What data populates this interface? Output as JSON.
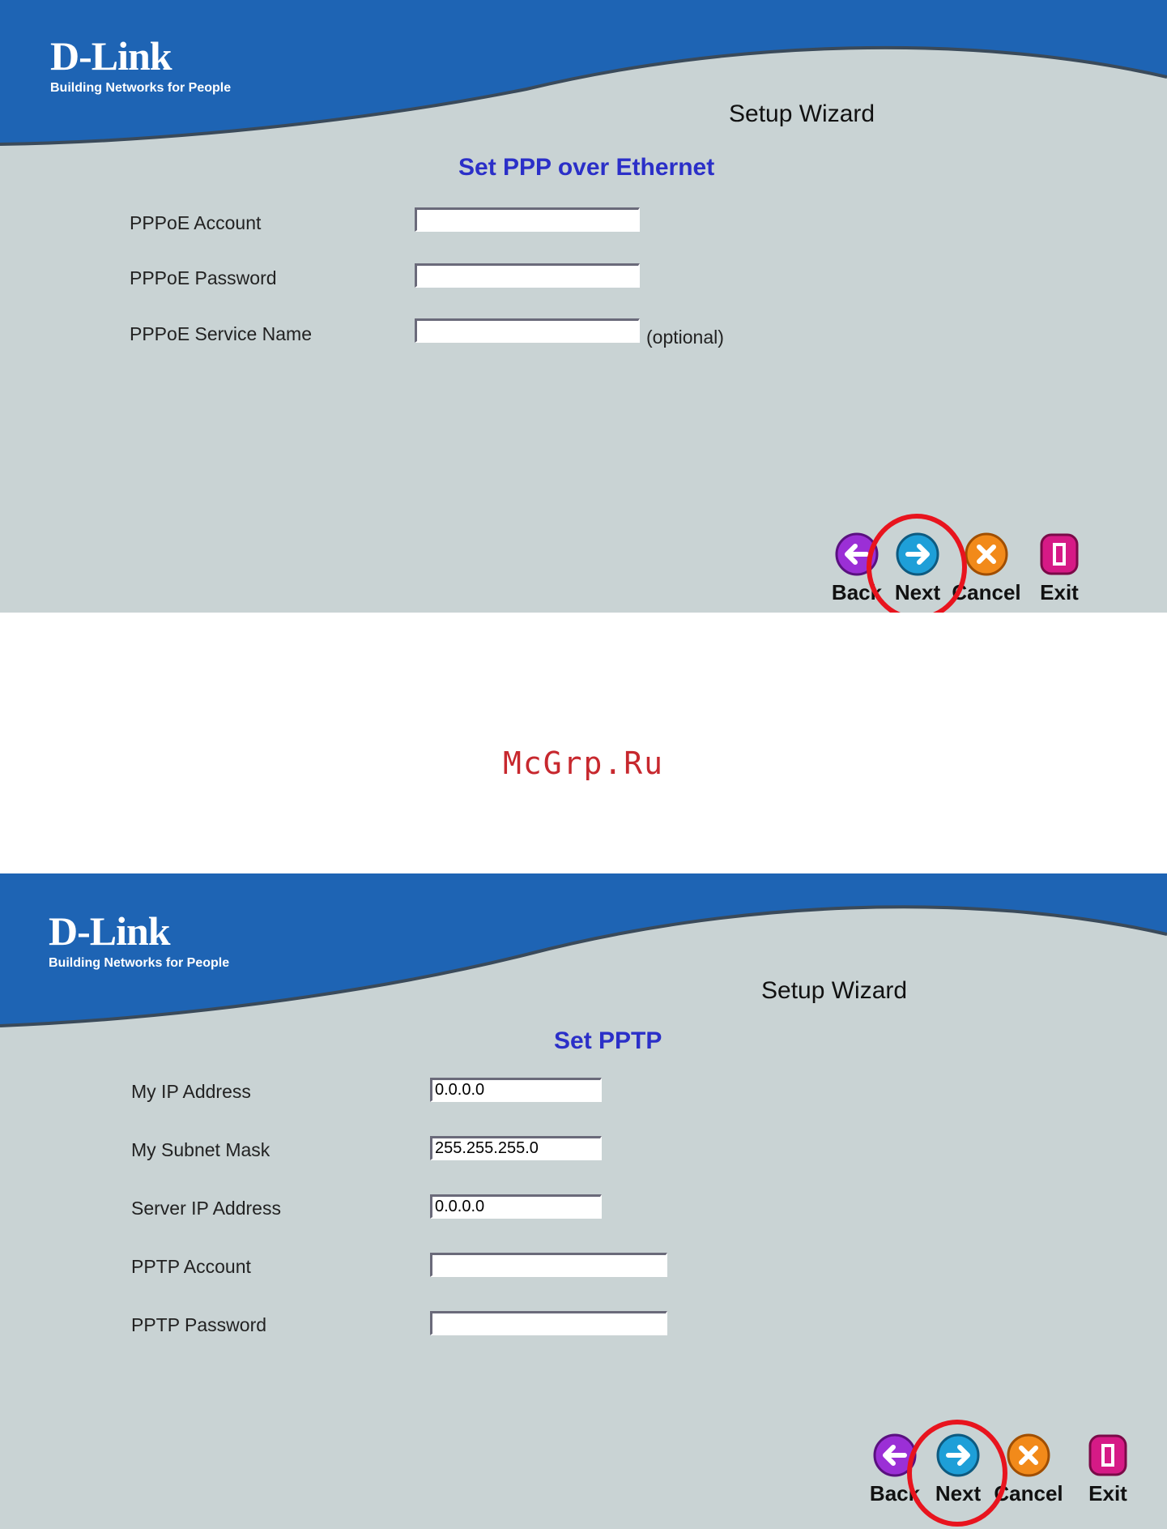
{
  "watermark": "McGrp.Ru",
  "colors": {
    "banner": "#1e64b4",
    "background": "#c9d3d4",
    "section_title": "#2b2fc8",
    "highlight": "#e8141e"
  },
  "panels": [
    {
      "logo": {
        "brand": "D-Link",
        "tagline": "Building Networks for People"
      },
      "wizard_title": "Setup Wizard",
      "section_title": "Set PPP over Ethernet",
      "fields": [
        {
          "label": "PPPoE Account",
          "value": ""
        },
        {
          "label": "PPPoE Password",
          "value": ""
        },
        {
          "label": "PPPoE Service Name",
          "value": "",
          "note": "(optional)"
        }
      ],
      "buttons": [
        {
          "label": "Back",
          "icon": "back-arrow-icon"
        },
        {
          "label": "Next",
          "icon": "next-arrow-icon"
        },
        {
          "label": "Cancel",
          "icon": "cancel-x-icon"
        },
        {
          "label": "Exit",
          "icon": "exit-door-icon"
        }
      ]
    },
    {
      "logo": {
        "brand": "D-Link",
        "tagline": "Building Networks for People"
      },
      "wizard_title": "Setup Wizard",
      "section_title": "Set PPTP",
      "fields": [
        {
          "label": "My IP Address",
          "value": "0.0.0.0"
        },
        {
          "label": "My Subnet Mask",
          "value": "255.255.255.0"
        },
        {
          "label": "Server IP Address",
          "value": "0.0.0.0"
        },
        {
          "label": "PPTP Account",
          "value": ""
        },
        {
          "label": "PPTP Password",
          "value": ""
        }
      ],
      "buttons": [
        {
          "label": "Back",
          "icon": "back-arrow-icon"
        },
        {
          "label": "Next",
          "icon": "next-arrow-icon"
        },
        {
          "label": "Cancel",
          "icon": "cancel-x-icon"
        },
        {
          "label": "Exit",
          "icon": "exit-door-icon"
        }
      ]
    }
  ]
}
